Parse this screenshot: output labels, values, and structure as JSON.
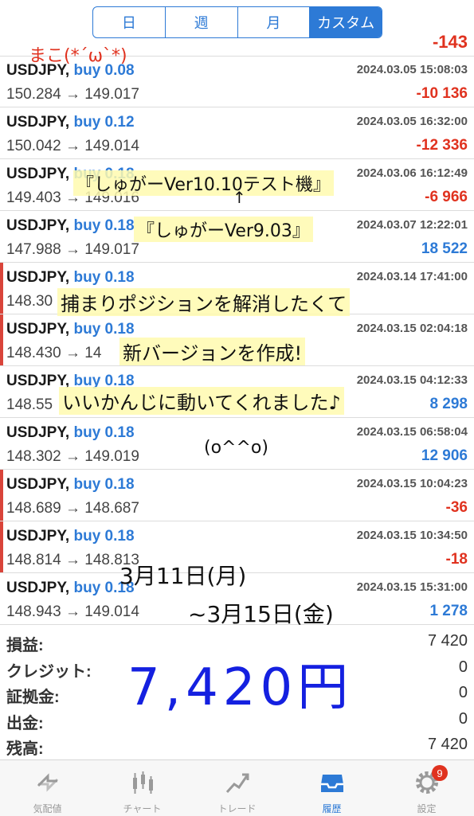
{
  "segments": [
    {
      "label": "日",
      "active": false
    },
    {
      "label": "週",
      "active": false
    },
    {
      "label": "月",
      "active": false
    },
    {
      "label": "カスタム",
      "active": true
    }
  ],
  "top_row_partial_profit": "-143",
  "trades": [
    {
      "symbol": "USDJPY,",
      "side": "buy 0.08",
      "time": "2024.03.05 15:08:03",
      "open": "150.284",
      "close": "149.017",
      "profit": "-10 136",
      "profit_sign": "neg",
      "marked": false
    },
    {
      "symbol": "USDJPY,",
      "side": "buy 0.12",
      "time": "2024.03.05 16:32:00",
      "open": "150.042",
      "close": "149.014",
      "profit": "-12 336",
      "profit_sign": "neg",
      "marked": false
    },
    {
      "symbol": "USDJPY,",
      "side": "buy 0.18",
      "time": "2024.03.06 16:12:49",
      "open": "149.403",
      "close": "149.016",
      "profit": "-6 966",
      "profit_sign": "neg",
      "marked": false
    },
    {
      "symbol": "USDJPY,",
      "side": "buy 0.18",
      "time": "2024.03.07 12:22:01",
      "open": "147.988",
      "close": "149.017",
      "profit": "18 522",
      "profit_sign": "pos",
      "marked": false
    },
    {
      "symbol": "USDJPY,",
      "side": "buy 0.18",
      "time": "2024.03.14 17:41:00",
      "open": "148.30",
      "close": "",
      "profit": "",
      "profit_sign": "neg",
      "marked": true
    },
    {
      "symbol": "USDJPY,",
      "side": "buy 0.18",
      "time": "2024.03.15 02:04:18",
      "open": "148.430",
      "close": "14",
      "profit": "",
      "profit_sign": "neg",
      "marked": true
    },
    {
      "symbol": "USDJPY,",
      "side": "buy 0.18",
      "time": "2024.03.15 04:12:33",
      "open": "148.55",
      "close": "",
      "profit": "8 298",
      "profit_sign": "pos",
      "marked": false
    },
    {
      "symbol": "USDJPY,",
      "side": "buy 0.18",
      "time": "2024.03.15 06:58:04",
      "open": "148.302",
      "close": "149.019",
      "profit": "12 906",
      "profit_sign": "pos",
      "marked": false
    },
    {
      "symbol": "USDJPY,",
      "side": "buy 0.18",
      "time": "2024.03.15 10:04:23",
      "open": "148.689",
      "close": "148.687",
      "profit": "-36",
      "profit_sign": "neg",
      "marked": true
    },
    {
      "symbol": "USDJPY,",
      "side": "buy 0.18",
      "time": "2024.03.15 10:34:50",
      "open": "148.814",
      "close": "148.813",
      "profit": "-18",
      "profit_sign": "neg",
      "marked": true
    },
    {
      "symbol": "USDJPY,",
      "side": "buy 0.18",
      "time": "2024.03.15 15:31:00",
      "open": "148.943",
      "close": "149.014",
      "profit": "1 278",
      "profit_sign": "pos",
      "marked": false
    }
  ],
  "summary": [
    {
      "label": "損益:",
      "value": "7 420"
    },
    {
      "label": "クレジット:",
      "value": "0"
    },
    {
      "label": "証拠金:",
      "value": "0"
    },
    {
      "label": "出金:",
      "value": "0"
    },
    {
      "label": "残高:",
      "value": "7 420"
    }
  ],
  "annotations": {
    "top_note": "まこ(*´ω`*)",
    "ver10": "『しゅがーVer10.10テスト機』",
    "arrow": "↑",
    "ver9": "『しゅがーVer9.03』",
    "note1": "捕まりポジションを解消したくて",
    "note2": "新バージョンを作成!",
    "note3": "いいかんじに動いてくれました♪",
    "face": "(o^^o)",
    "period_start": "3月11日(月)",
    "period_end": "~3月15日(金)",
    "total_yen": "7,420円"
  },
  "tabs": [
    {
      "label": "気配値",
      "icon": "quotes-icon",
      "active": false
    },
    {
      "label": "チャート",
      "icon": "chart-icon",
      "active": false
    },
    {
      "label": "トレード",
      "icon": "trade-icon",
      "active": false
    },
    {
      "label": "履歴",
      "icon": "history-icon",
      "active": true
    },
    {
      "label": "設定",
      "icon": "gear-icon",
      "active": false,
      "badge": "9"
    }
  ],
  "colors": {
    "accent": "#2d7ad6",
    "loss": "#e0321f",
    "marker": "#d9443a",
    "handwriting_blue": "#1420e0"
  }
}
